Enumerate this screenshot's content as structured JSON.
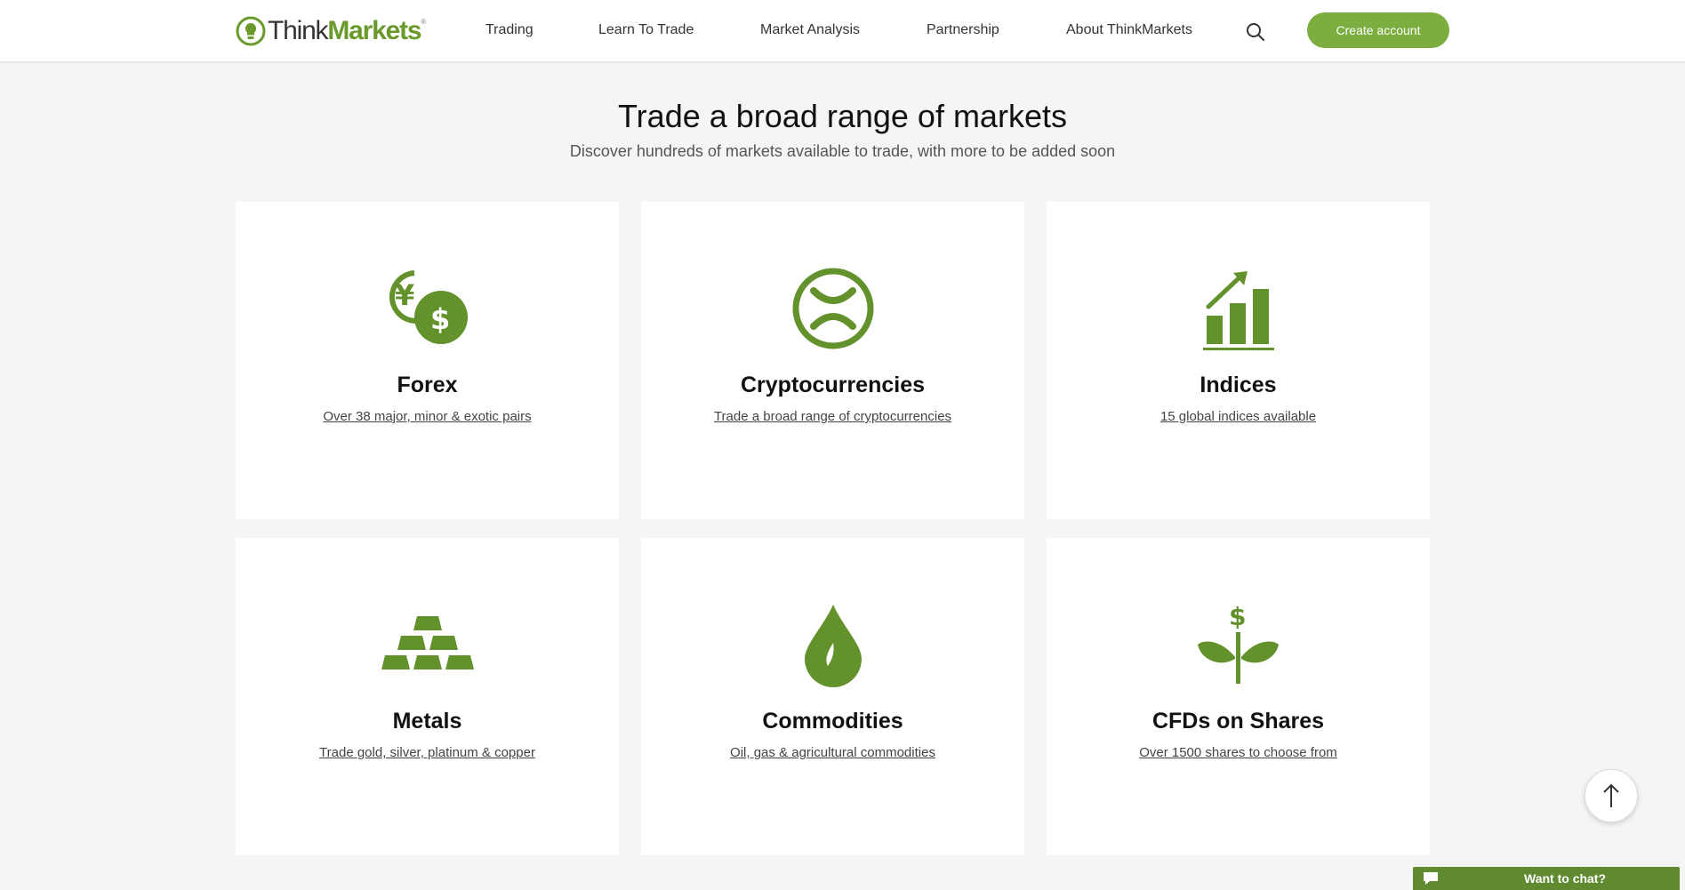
{
  "colors": {
    "brand_green": "#6a9a2c",
    "icon_green": "#63922d",
    "button_green": "#7cad3f",
    "chat_green": "#5f8a30",
    "page_bg": "#f5f5f5"
  },
  "header": {
    "logo": {
      "think": "Think",
      "markets": "Markets",
      "registered": "®"
    },
    "nav": [
      "Trading",
      "Learn To Trade",
      "Market Analysis",
      "Partnership",
      "About ThinkMarkets"
    ],
    "search_icon": "search-icon",
    "cta_label": "Create account"
  },
  "hero": {
    "title": "Trade a broad range of markets",
    "subtitle": "Discover hundreds of markets available to trade, with more to be added soon"
  },
  "cards": [
    {
      "title": "Forex",
      "link": "Over 38 major, minor & exotic pairs",
      "icon": "currency-exchange-icon"
    },
    {
      "title": "Cryptocurrencies",
      "link": "Trade a broad range of cryptocurrencies",
      "icon": "crypto-coin-icon"
    },
    {
      "title": "Indices",
      "link": "15 global indices available",
      "icon": "bar-chart-growth-icon"
    },
    {
      "title": "Metals",
      "link": "Trade gold, silver, platinum & copper",
      "icon": "gold-bars-icon"
    },
    {
      "title": "Commodities",
      "link": "Oil, gas & agricultural commodities",
      "icon": "oil-drop-icon"
    },
    {
      "title": "CFDs on Shares",
      "link": "Over 1500 shares to choose from",
      "icon": "money-plant-icon"
    }
  ],
  "back_to_top_icon": "arrow-up-icon",
  "chat": {
    "label": "Want to chat?",
    "icon": "chat-bubble-icon"
  }
}
